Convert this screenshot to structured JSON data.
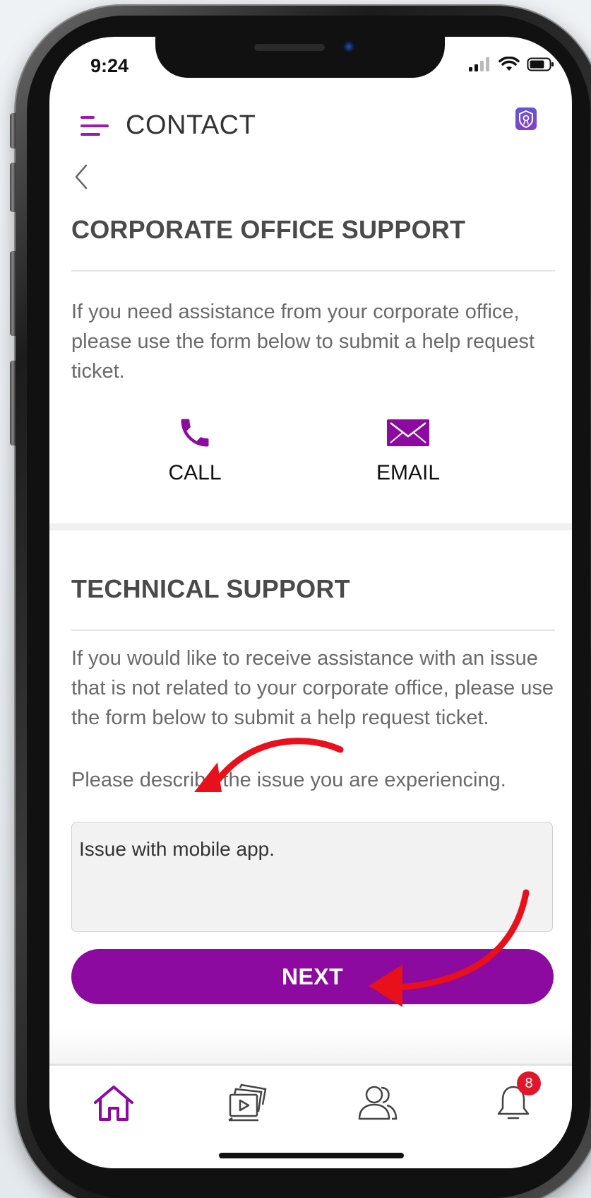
{
  "status_bar": {
    "time": "9:24"
  },
  "header": {
    "title": "CONTACT",
    "menu_icon": "hamburger-menu-icon",
    "brand_icon": "app-logo-icon"
  },
  "corporate_section": {
    "title": "CORPORATE OFFICE SUPPORT",
    "description": "If you need assistance from your corporate office, please use the form below to submit a help request ticket.",
    "call_label": "CALL",
    "email_label": "EMAIL"
  },
  "technical_section": {
    "title": "TECHNICAL SUPPORT",
    "description": "If you would like to receive assistance with an issue that is not related to your corporate office, please use the form below to submit a help request ticket.",
    "prompt": "Please describe the issue you are experiencing.",
    "issue_value": "Issue with mobile app.",
    "next_label": "NEXT"
  },
  "tab_bar": {
    "items": [
      {
        "name": "home",
        "icon": "home-icon"
      },
      {
        "name": "media",
        "icon": "media-icon"
      },
      {
        "name": "people",
        "icon": "people-icon"
      },
      {
        "name": "notifications",
        "icon": "bell-icon",
        "badge": "8"
      }
    ]
  },
  "colors": {
    "accent": "#8c0aa0",
    "badge": "#e0162b",
    "annotation": "#e8101a"
  }
}
